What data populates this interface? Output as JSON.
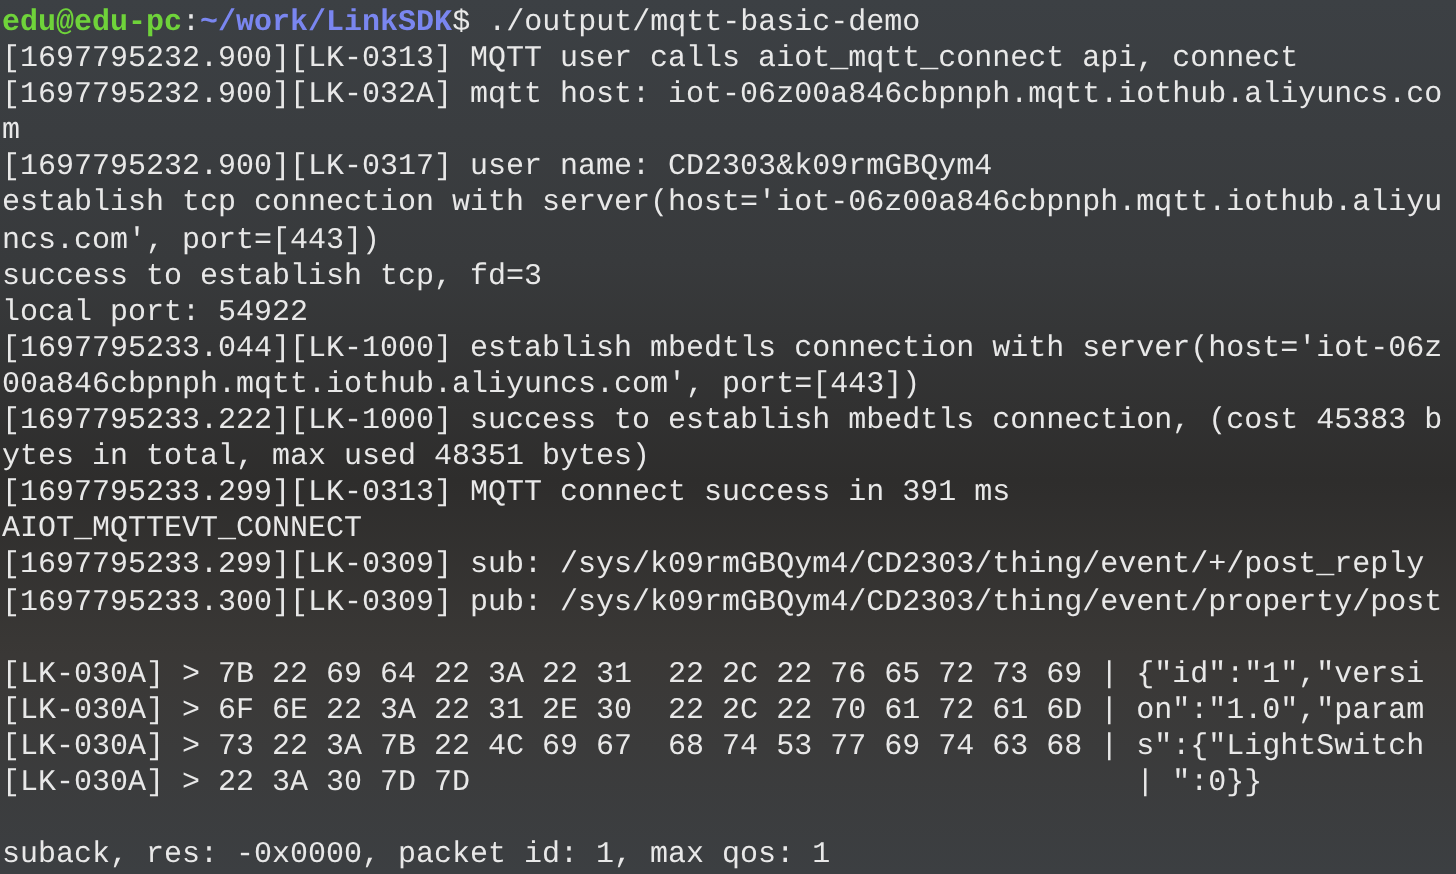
{
  "prompt": {
    "user_host": "edu@edu-pc",
    "separator": ":",
    "path": "~/work/LinkSDK",
    "symbol": "$",
    "command": " ./output/mqtt-basic-demo"
  },
  "lines": [
    {
      "kind": "text",
      "text": "[1697795232.900][LK-0313] MQTT user calls aiot_mqtt_connect api, connect"
    },
    {
      "kind": "text",
      "text": "[1697795232.900][LK-032A] mqtt host: iot-06z00a846cbpnph.mqtt.iothub.aliyuncs.co"
    },
    {
      "kind": "text",
      "text": "m"
    },
    {
      "kind": "text",
      "text": "[1697795232.900][LK-0317] user name: CD2303&k09rmGBQym4"
    },
    {
      "kind": "text",
      "text": "establish tcp connection with server(host='iot-06z00a846cbpnph.mqtt.iothub.aliyu"
    },
    {
      "kind": "text",
      "text": "ncs.com', port=[443])"
    },
    {
      "kind": "text",
      "text": "success to establish tcp, fd=3"
    },
    {
      "kind": "text",
      "text": "local port: 54922"
    },
    {
      "kind": "text",
      "text": "[1697795233.044][LK-1000] establish mbedtls connection with server(host='iot-06z"
    },
    {
      "kind": "text",
      "text": "00a846cbpnph.mqtt.iothub.aliyuncs.com', port=[443])"
    },
    {
      "kind": "text",
      "text": "[1697795233.222][LK-1000] success to establish mbedtls connection, (cost 45383 b"
    },
    {
      "kind": "text",
      "text": "ytes in total, max used 48351 bytes)"
    },
    {
      "kind": "text",
      "text": "[1697795233.299][LK-0313] MQTT connect success in 391 ms"
    },
    {
      "kind": "text",
      "text": "AIOT_MQTTEVT_CONNECT"
    },
    {
      "kind": "text",
      "text": "[1697795233.299][LK-0309] sub: /sys/k09rmGBQym4/CD2303/thing/event/+/post_reply"
    },
    {
      "kind": "text",
      "text": "[1697795233.300][LK-0309] pub: /sys/k09rmGBQym4/CD2303/thing/event/property/post"
    },
    {
      "kind": "blank"
    },
    {
      "kind": "text",
      "text": "[LK-030A] > 7B 22 69 64 22 3A 22 31  22 2C 22 76 65 72 73 69 | {\"id\":\"1\",\"versi"
    },
    {
      "kind": "text",
      "text": "[LK-030A] > 6F 6E 22 3A 22 31 2E 30  22 2C 22 70 61 72 61 6D | on\":\"1.0\",\"param"
    },
    {
      "kind": "text",
      "text": "[LK-030A] > 73 22 3A 7B 22 4C 69 67  68 74 53 77 69 74 63 68 | s\":{\"LightSwitch"
    },
    {
      "kind": "text",
      "text": "[LK-030A] > 22 3A 30 7D 7D                                     | \":0}}"
    },
    {
      "kind": "blank"
    },
    {
      "kind": "text",
      "text": "suback, res: -0x0000, packet id: 1, max qos: 1"
    }
  ]
}
